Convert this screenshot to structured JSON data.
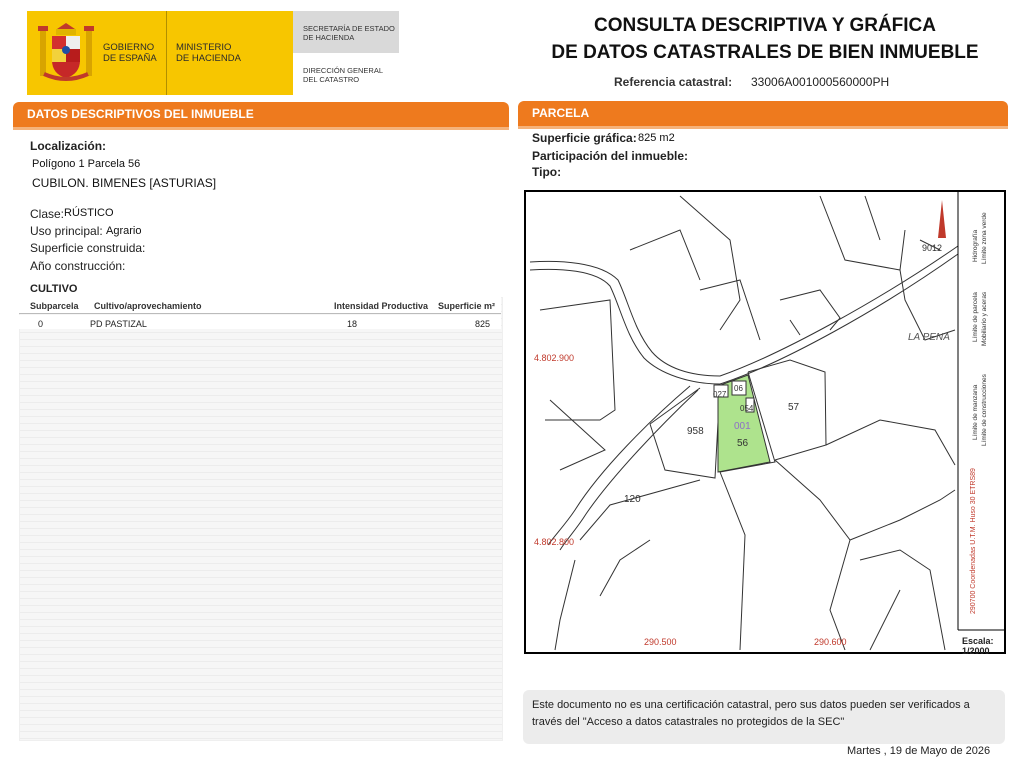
{
  "header": {
    "gov_line1": "GOBIERNO",
    "gov_line2": "DE ESPAÑA",
    "min_line1": "MINISTERIO",
    "min_line2": "DE HACIENDA",
    "sec_line1": "SECRETARÍA DE ESTADO",
    "sec_line2": "DE HACIENDA",
    "dg_line1": "DIRECCIÓN GENERAL",
    "dg_line2": "DEL CATASTRO",
    "title_line1": "CONSULTA DESCRIPTIVA Y GRÁFICA",
    "title_line2": "DE DATOS CATASTRALES DE BIEN INMUEBLE",
    "ref_label": "Referencia catastral:",
    "ref_value": "33006A001000560000PH"
  },
  "left": {
    "section_title": "DATOS DESCRIPTIVOS DEL INMUEBLE",
    "localizacion_label": "Localización:",
    "localizacion_line1": "Polígono 1 Parcela 56",
    "localizacion_line2": "CUBILON. BIMENES [ASTURIAS]",
    "clase_label": "Clase:",
    "clase_value": "RÚSTICO",
    "uso_label": "Uso principal:",
    "uso_value": "Agrario",
    "sup_construida_label": "Superficie construida:",
    "anio_label": "Año construcción:",
    "cultivo_title": "CULTIVO",
    "table": {
      "headers": [
        "Subparcela",
        "Cultivo/aprovechamiento",
        "Intensidad Productiva",
        "Superficie m²"
      ],
      "rows": [
        [
          "0",
          "PD PASTIZAL",
          "18",
          "825"
        ]
      ]
    }
  },
  "right": {
    "section_title": "PARCELA",
    "sup_grafica_label": "Superficie gráfica:",
    "sup_grafica_value": "825 m2",
    "participacion_label": "Participación del inmueble:",
    "tipo_label": "Tipo:"
  },
  "map": {
    "labels": {
      "la_pena": "LA PENA",
      "p57": "57",
      "p56": "56",
      "p001": "001",
      "p958": "958",
      "p120": "120",
      "p9012": "9012",
      "p06": "06",
      "p054": "054",
      "p027": "027",
      "y_top": "4.802.900",
      "y_bottom": "4.802.800",
      "x_left": "290.500",
      "x_right": "290.600"
    },
    "legend": {
      "l1": "Límite de parcela",
      "l2": "Hidrografía",
      "l3": "Límite zona verde",
      "l4": "Mobiliario y aceras",
      "l5": "Límite de manzana",
      "l6": "Límite de construcciones",
      "coord": "290700 Coordenadas U.T.M. Huso 30 ETRS89"
    },
    "scale_label": "Escala:",
    "scale_value": "1/2000"
  },
  "note": "Este documento no es una certificación catastral, pero sus datos pueden ser verificados a través del \"Acceso a datos catastrales no protegidos de la SEC\"",
  "date": "Martes , 19 de Mayo de 2026",
  "colors": {
    "accent": "#ee7a1e",
    "logo_yellow": "#f7c600",
    "parcel_green": "#aee38d"
  }
}
